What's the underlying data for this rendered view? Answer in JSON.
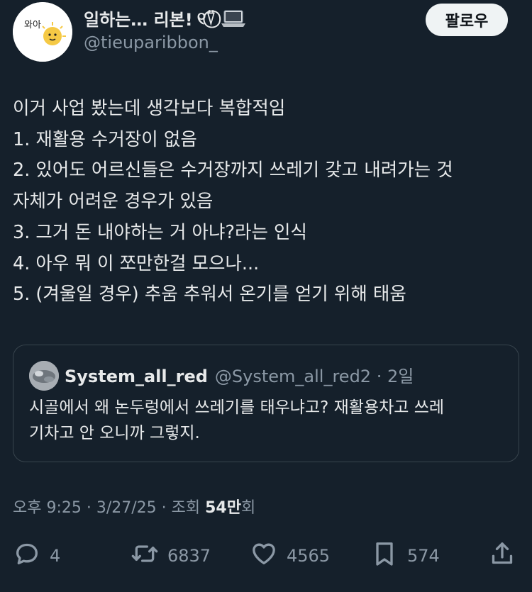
{
  "header": {
    "name": "일하는… 리본!",
    "name_suffix": "୧⍢⃝",
    "handle": "@tieuparibbon_",
    "follow_label": "팔로우",
    "avatar_text": "와아"
  },
  "tweet": {
    "lines": [
      "이거 사업 봤는데 생각보다 복합적임",
      "1. 재활용 수거장이 없음",
      "2. 있어도 어르신들은 수거장까지 쓰레기 갖고 내려가는 것",
      "자체가 어려운 경우가 있음",
      "3. 그거 돈 내야하는 거 아냐?라는 인식",
      "4. 아우 뭐 이 쪼만한걸 모으나...",
      "5. (겨울일 경우) 추움 추워서 온기를 얻기 위해 태움"
    ]
  },
  "quote": {
    "name": "System_all_red",
    "handle_time": "@System_all_red2 · 2일",
    "lines": [
      "시골에서 왜 논두렁에서 쓰레기를 태우냐고? 재활용차고 쓰레",
      "기차고 안 오니까 그렇지."
    ]
  },
  "meta": {
    "time_date": "오후 9:25 · 3/27/25 · 조회 ",
    "views": "54만",
    "views_suffix": "회"
  },
  "actions": {
    "replies": "4",
    "retweets": "6837",
    "likes": "4565",
    "bookmarks": "574"
  },
  "icons": {
    "reply": "reply-icon",
    "retweet": "retweet-icon",
    "like": "heart-icon",
    "bookmark": "bookmark-icon",
    "share": "share-icon",
    "laptop": "laptop-icon"
  },
  "colors": {
    "background": "#15202b",
    "text": "#e7e9ea",
    "muted": "#8b98a5",
    "border": "#38444d",
    "follow_bg": "#eff3f4"
  }
}
